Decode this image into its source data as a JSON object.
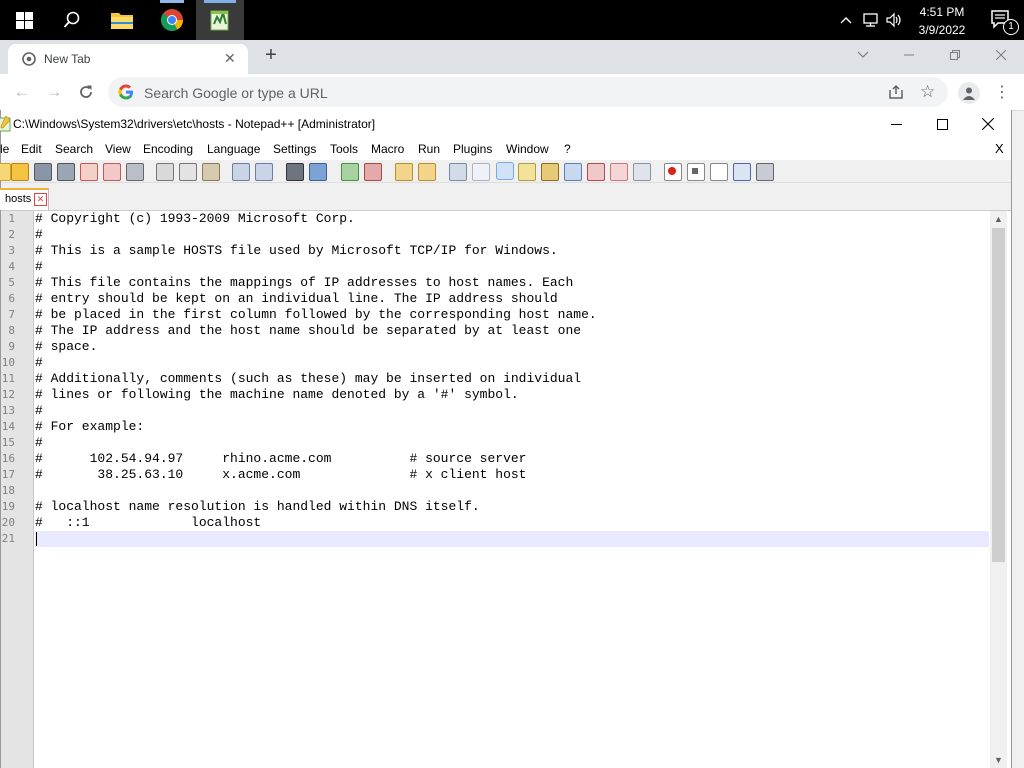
{
  "taskbar": {
    "clock": {
      "time": "4:51 PM",
      "date": "3/9/2022"
    },
    "notification_count": "1"
  },
  "chrome": {
    "tab_title": "New Tab",
    "omnibox_placeholder": "Search Google or type a URL"
  },
  "npp": {
    "title": "C:\\Windows\\System32\\drivers\\etc\\hosts - Notepad++ [Administrator]",
    "menu": [
      "le",
      "Edit",
      "Search",
      "View",
      "Encoding",
      "Language",
      "Settings",
      "Tools",
      "Macro",
      "Run",
      "Plugins",
      "Window",
      "?"
    ],
    "close_doc": "X",
    "doc_tab": "hosts",
    "line_numbers": [
      "1",
      "2",
      "3",
      "4",
      "5",
      "6",
      "7",
      "8",
      "9",
      "10",
      "11",
      "12",
      "13",
      "14",
      "15",
      "16",
      "17",
      "18",
      "19",
      "20",
      "21"
    ],
    "lines": [
      "# Copyright (c) 1993-2009 Microsoft Corp.",
      "#",
      "# This is a sample HOSTS file used by Microsoft TCP/IP for Windows.",
      "#",
      "# This file contains the mappings of IP addresses to host names. Each",
      "# entry should be kept on an individual line. The IP address should",
      "# be placed in the first column followed by the corresponding host name.",
      "# The IP address and the host name should be separated by at least one",
      "# space.",
      "#",
      "# Additionally, comments (such as these) may be inserted on individual",
      "# lines or following the machine name denoted by a '#' symbol.",
      "#",
      "# For example:",
      "#",
      "#      102.54.94.97     rhino.acme.com          # source server",
      "#       38.25.63.10     x.acme.com              # x client host",
      "",
      "# localhost name resolution is handled within DNS itself.",
      "#   ::1             localhost",
      ""
    ]
  }
}
